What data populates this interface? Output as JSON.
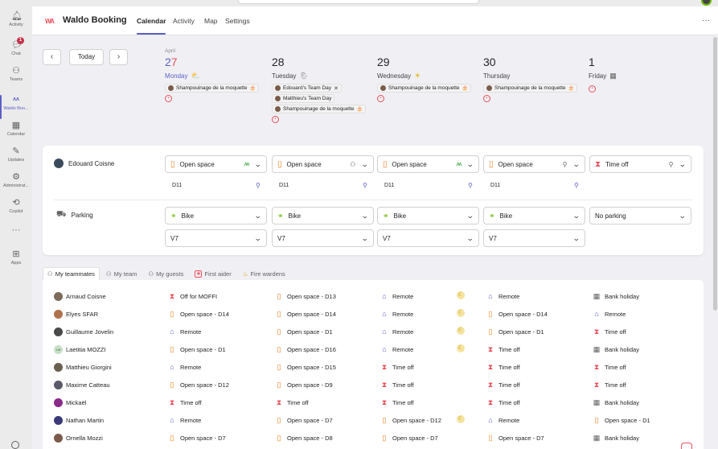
{
  "rail": {
    "items": [
      {
        "label": "Activity",
        "icon": "bell-icon"
      },
      {
        "label": "Chat",
        "icon": "chat-icon",
        "badge": "1"
      },
      {
        "label": "Teams",
        "icon": "teams-icon"
      },
      {
        "label": "Waldo Boo...",
        "icon": "waldo-icon"
      },
      {
        "label": "Calendar",
        "icon": "calendar-icon"
      },
      {
        "label": "Updates",
        "icon": "updates-icon"
      },
      {
        "label": "Administrat...",
        "icon": "admin-icon"
      },
      {
        "label": "Copilot",
        "icon": "copilot-icon"
      },
      {
        "label": "",
        "icon": "more-horizontal-icon"
      },
      {
        "label": "Apps",
        "icon": "apps-icon"
      }
    ]
  },
  "app": {
    "logo": "WA",
    "title": "Waldo Booking",
    "tabs": [
      "Calendar",
      "Activity",
      "Map",
      "Settings"
    ],
    "more": "···"
  },
  "nav": {
    "prev": "‹",
    "today": "Today",
    "next": "›"
  },
  "days": [
    {
      "month": "April",
      "num": "27",
      "weekday": "Monday",
      "today": true,
      "weather": "⛅",
      "events": [
        {
          "text": "Shampouinage de la moquette",
          "tail": "🎂"
        }
      ]
    },
    {
      "month": "",
      "num": "28",
      "weekday": "Tuesday",
      "today": false,
      "weather": "🌦",
      "events": [
        {
          "text": "Edouard's Team Day",
          "tail": "✕"
        },
        {
          "text": "Matthieu's Team Day",
          "tail": ""
        },
        {
          "text": "Shampouinage de la moquette",
          "tail": "🎂"
        }
      ]
    },
    {
      "month": "",
      "num": "29",
      "weekday": "Wednesday",
      "today": false,
      "weather": "☀",
      "events": [
        {
          "text": "Shampouinage de la moquette",
          "tail": "🎂"
        }
      ]
    },
    {
      "month": "",
      "num": "30",
      "weekday": "Thursday",
      "today": false,
      "weather": "",
      "events": [
        {
          "text": "Shampouinage de la moquette",
          "tail": "🎂"
        }
      ]
    },
    {
      "month": "",
      "num": "1",
      "weekday": "Friday",
      "today": false,
      "weather": "▦",
      "events": []
    }
  ],
  "person_row": {
    "name": "Edouard Coisne",
    "selects": [
      {
        "icon": "desk",
        "label": "Open space",
        "extra": "wa",
        "desk": "D11"
      },
      {
        "icon": "desk",
        "label": "Open space",
        "extra": "people",
        "desk": "D11"
      },
      {
        "icon": "desk",
        "label": "Open space",
        "extra": "wa",
        "desk": "D11"
      },
      {
        "icon": "desk",
        "label": "Open space",
        "extra": "pin",
        "desk": "D11"
      },
      {
        "icon": "hour",
        "label": "Time off",
        "extra": "pin",
        "desk": ""
      }
    ]
  },
  "parking_row": {
    "label": "Parking",
    "selects": [
      {
        "icon": "bike",
        "label": "Bike",
        "spot": "V7"
      },
      {
        "icon": "bike",
        "label": "Bike",
        "spot": "V7"
      },
      {
        "icon": "bike",
        "label": "Bike",
        "spot": "V7"
      },
      {
        "icon": "bike",
        "label": "Bike",
        "spot": "V7"
      },
      {
        "icon": "none",
        "label": "No parking",
        "spot": ""
      }
    ]
  },
  "team_tabs": [
    {
      "label": "My teammates",
      "icon": "people-icon",
      "active": true
    },
    {
      "label": "My team",
      "icon": "people-icon",
      "active": false
    },
    {
      "label": "My guests",
      "icon": "people-icon",
      "active": false
    },
    {
      "label": "First aider",
      "icon": "first-aid-icon",
      "active": false
    },
    {
      "label": "Fire wardens",
      "icon": "fire-icon",
      "active": false
    }
  ],
  "teammates": [
    {
      "name": "Arnaud Coisne",
      "initials": "",
      "cells": [
        [
          "hour",
          "Off for MOFFI"
        ],
        [
          "desk",
          "Open space  - D13"
        ],
        [
          "home",
          "Remote"
        ],
        [
          "home",
          "Remote"
        ],
        [
          "cal",
          "Bank holiday"
        ]
      ],
      "moon": 2
    },
    {
      "name": "Elyes SFAR",
      "initials": "",
      "cells": [
        [
          "desk",
          "Open space  - D14"
        ],
        [
          "desk",
          "Open space  - D14"
        ],
        [
          "home",
          "Remote"
        ],
        [
          "desk",
          "Open space  - D14"
        ],
        [
          "home",
          "Remote"
        ]
      ],
      "moon": 2
    },
    {
      "name": "Guillaume Jovelin",
      "initials": "",
      "cells": [
        [
          "home",
          "Remote"
        ],
        [
          "desk",
          "Open space  - D1"
        ],
        [
          "home",
          "Remote"
        ],
        [
          "desk",
          "Open space  - D1"
        ],
        [
          "hour",
          "Time off"
        ]
      ],
      "moon": 2
    },
    {
      "name": "Laetitia MOZZI",
      "initials": "LM",
      "cells": [
        [
          "desk",
          "Open space  - D1"
        ],
        [
          "desk",
          "Open space  - D16"
        ],
        [
          "home",
          "Remote"
        ],
        [
          "hour",
          "Time off"
        ],
        [
          "cal",
          "Bank holiday"
        ]
      ],
      "moon": 2
    },
    {
      "name": "Matthieu Giorgini",
      "initials": "",
      "cells": [
        [
          "home",
          "Remote"
        ],
        [
          "desk",
          "Open space  - D15"
        ],
        [
          "hour",
          "Time off"
        ],
        [
          "hour",
          "Time off"
        ],
        [
          "hour",
          "Time off"
        ]
      ],
      "moon": -1
    },
    {
      "name": "Maxime Catteau",
      "initials": "",
      "cells": [
        [
          "desk",
          "Open space  - D12"
        ],
        [
          "desk",
          "Open space  - D9"
        ],
        [
          "hour",
          "Time off"
        ],
        [
          "hour",
          "Time off"
        ],
        [
          "hour",
          "Time off"
        ]
      ],
      "moon": -1
    },
    {
      "name": "Mickaël",
      "initials": "",
      "cells": [
        [
          "hour",
          "Time off"
        ],
        [
          "hour",
          "Time off"
        ],
        [
          "hour",
          "Time off"
        ],
        [
          "hour",
          "Time off"
        ],
        [
          "cal",
          "Bank holiday"
        ]
      ],
      "moon": -1
    },
    {
      "name": "Nathan Martin",
      "initials": "",
      "cells": [
        [
          "home",
          "Remote"
        ],
        [
          "desk",
          "Open space  - D7"
        ],
        [
          "desk",
          "Open space  - D12"
        ],
        [
          "home",
          "Remote"
        ],
        [
          "desk",
          "Open space  - D1"
        ]
      ],
      "moon": 2
    },
    {
      "name": "Ornella Mozzi",
      "initials": "",
      "cells": [
        [
          "desk",
          "Open space  - D7"
        ],
        [
          "desk",
          "Open space  - D8"
        ],
        [
          "desk",
          "Open space  - D7"
        ],
        [
          "desk",
          "Open space  - D7"
        ],
        [
          "cal",
          "Bank holiday"
        ]
      ],
      "moon": -1
    }
  ],
  "colors": {
    "accent": "#5b5fc7",
    "brand": "#e8505b",
    "desk": "#e87f1e",
    "bike": "#6bb700"
  }
}
